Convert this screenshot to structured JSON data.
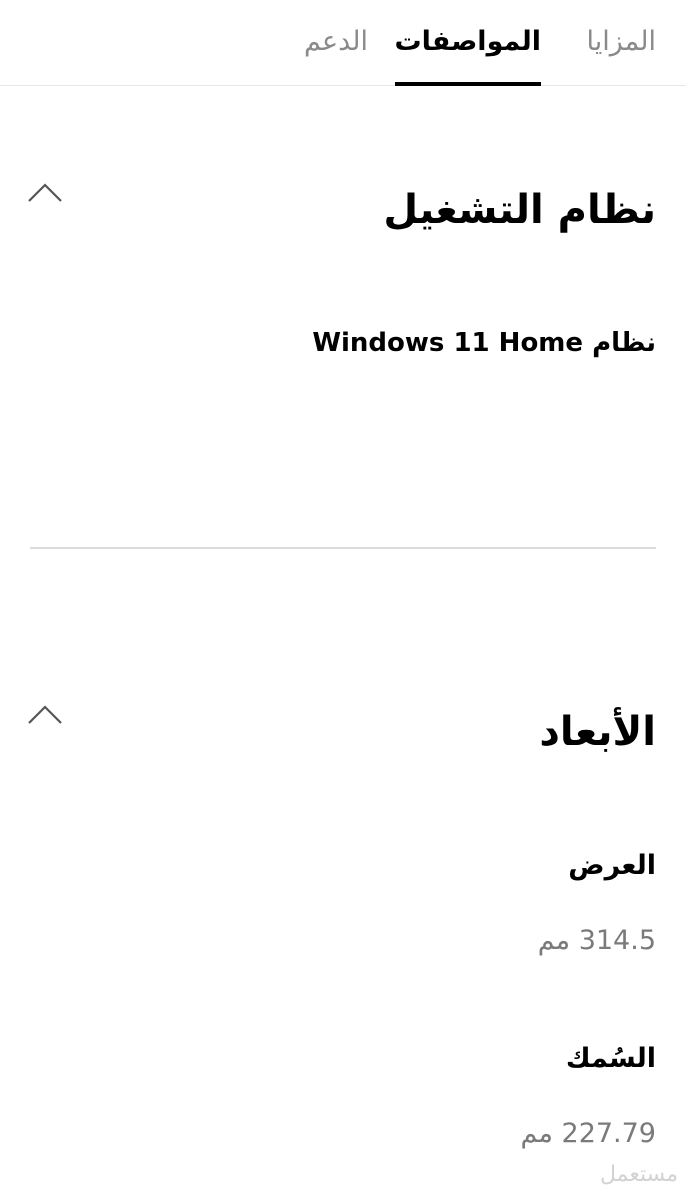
{
  "tabs": [
    {
      "label": "المزايا",
      "active": false
    },
    {
      "label": "المواصفات",
      "active": true
    },
    {
      "label": "الدعم",
      "active": false
    }
  ],
  "sections": {
    "os": {
      "title": "نظام التشغيل",
      "value": "نظام Windows 11 Home",
      "icon": "chevron-up-icon"
    },
    "dimensions": {
      "title": "الأبعاد",
      "icon": "chevron-up-icon",
      "items": [
        {
          "label": "العرض",
          "value": "314.5 مم"
        },
        {
          "label": "السُمك",
          "value": "227.79 مم"
        }
      ]
    }
  },
  "watermark": "مستعمل",
  "colors": {
    "active_tab": "#000000",
    "inactive_tab": "#8a8a8a",
    "value_text": "#7a7a7a",
    "divider": "#dcdcdc"
  }
}
